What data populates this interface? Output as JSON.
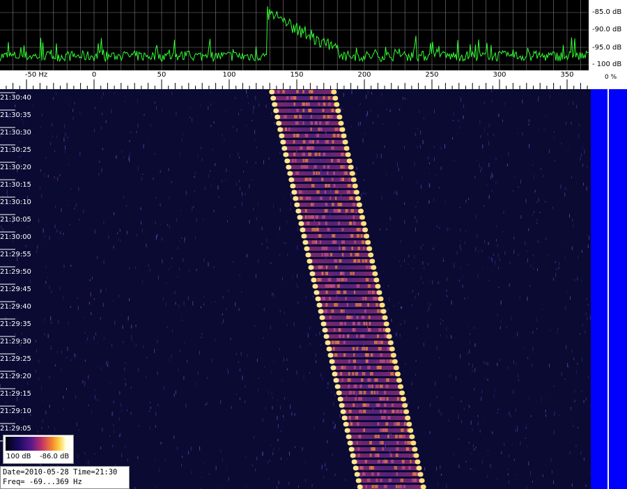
{
  "chart_data": {
    "type": "heatmap",
    "title": "",
    "xlabel": "Hz",
    "x_ticks": [
      -50,
      0,
      50,
      100,
      150,
      200,
      250,
      300,
      350
    ],
    "x_tick_labels": [
      "-50  Hz",
      "0",
      "50",
      "100",
      "150",
      "200",
      "250",
      "300",
      "350"
    ],
    "xlim": [
      -69,
      369
    ],
    "spectrum_db_ticks": [
      "-85.0 dB",
      "-90.0 dB",
      "-95.0 dB",
      "- 100 dB"
    ],
    "spectrum_db_range": [
      -100,
      -82
    ],
    "time_labels": [
      "21:30:40",
      "21:30:35",
      "21:30:30",
      "21:30:25",
      "21:30:20",
      "21:30:15",
      "21:30:10",
      "21:30:05",
      "21:30:00",
      "21:29:55",
      "21:29:50",
      "21:29:45",
      "21:29:40",
      "21:29:35",
      "21:29:30",
      "21:29:25",
      "21:29:20",
      "21:29:15",
      "21:29:10",
      "21:29:05"
    ],
    "signal_track": {
      "start_time": "21:30:40",
      "start_low_hz": 130,
      "start_high_hz": 179,
      "end_time": "21:29:00",
      "end_low_hz": 196,
      "end_high_hz": 246
    },
    "color_scale": {
      "min_label": "100 dB",
      "max_label": "-86.0 dB"
    }
  },
  "percent_label": "0  %",
  "info": {
    "date_time": "Date=2010-05-28 Time=21:30",
    "freq": "Freq= -69...369 Hz"
  },
  "colors": {
    "spectrum_line": "#33ff33",
    "grid": "#808080",
    "waterfall_bg": "#0a0a33",
    "side_bar": "#0000ff"
  }
}
